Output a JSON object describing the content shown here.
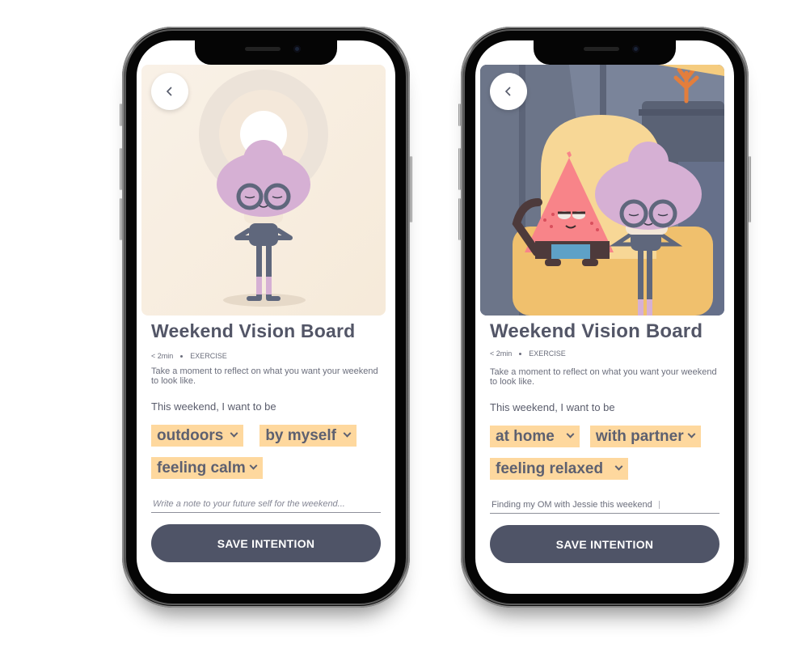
{
  "phones": [
    {
      "title": "Weekend Vision Board",
      "duration": "< 2min",
      "category": "EXERCISE",
      "description": "Take a moment to reflect on what you want your weekend to look like.",
      "prompt": "This weekend, I want to be",
      "chips": [
        {
          "label": "outdoors"
        },
        {
          "label": "by myself"
        },
        {
          "label": "feeling calm"
        }
      ],
      "note": {
        "value": "",
        "placeholder": "Write a note to your future self for the weekend..."
      },
      "save_label": "SAVE INTENTION",
      "illustration": "meditating-character-sunrise"
    },
    {
      "title": "Weekend Vision Board",
      "duration": "< 2min",
      "category": "EXERCISE",
      "description": "Take a moment to reflect on what you want your weekend to look like.",
      "prompt": "This weekend, I want to be",
      "chips": [
        {
          "label": "at home"
        },
        {
          "label": "with partner"
        },
        {
          "label": "feeling relaxed"
        }
      ],
      "note": {
        "value": "Finding my OM with Jessie this weekend",
        "placeholder": ""
      },
      "save_label": "SAVE INTENTION",
      "illustration": "characters-on-armchair"
    }
  ],
  "colors": {
    "chip_bg": "#fed89e",
    "button_bg": "#4f5467",
    "title_text": "#535667",
    "hair": "#d6b0d4"
  }
}
